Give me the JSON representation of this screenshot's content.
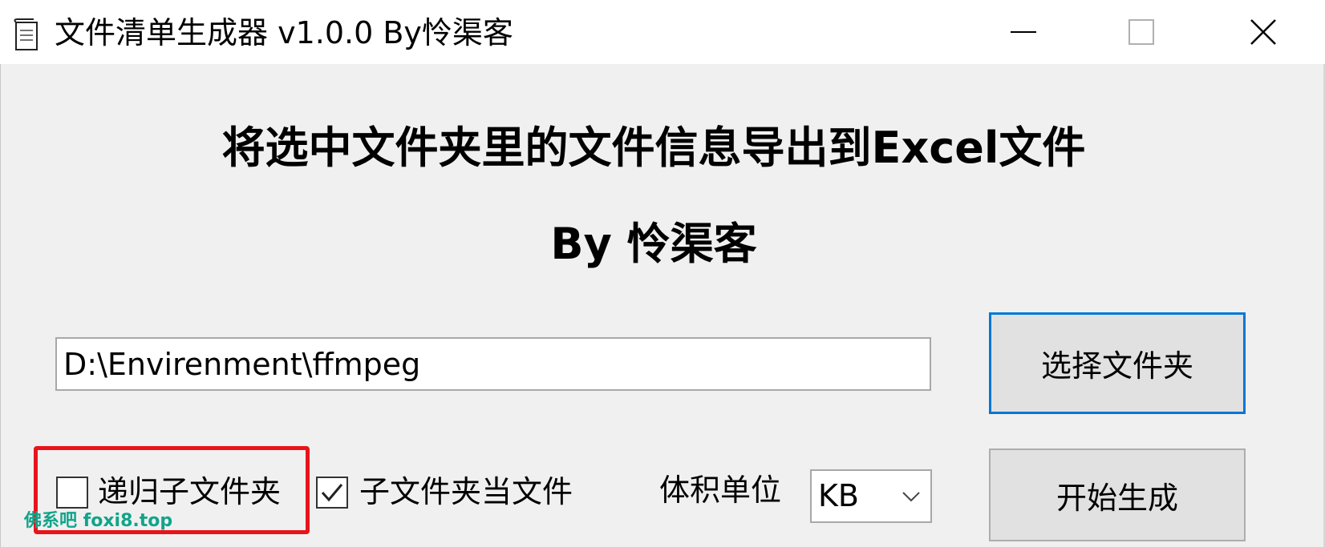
{
  "window": {
    "title": "文件清单生成器 v1.0.0 By怜渠客",
    "app_icon": "notepad-icon",
    "controls": [
      "minimize-icon",
      "maximize-icon",
      "close-icon"
    ]
  },
  "main": {
    "heading": "将选中文件夹里的文件信息导出到Excel文件",
    "subheading": "By 怜渠客",
    "path_value": "D:\\Envirenment\\ffmpeg",
    "select_folder_label": "选择文件夹",
    "start_label": "开始生成",
    "recurse_label": "递归子文件夹",
    "recurse_checked": false,
    "subfolder_as_file_label": "子文件夹当文件",
    "subfolder_as_file_checked": true,
    "unit_label": "体积单位",
    "unit_value": "KB"
  },
  "watermark": "佛系吧 foxi8.top",
  "colors": {
    "focus_border": "#0078d7",
    "highlight": "#e8141a",
    "watermark": "#11a48a"
  }
}
